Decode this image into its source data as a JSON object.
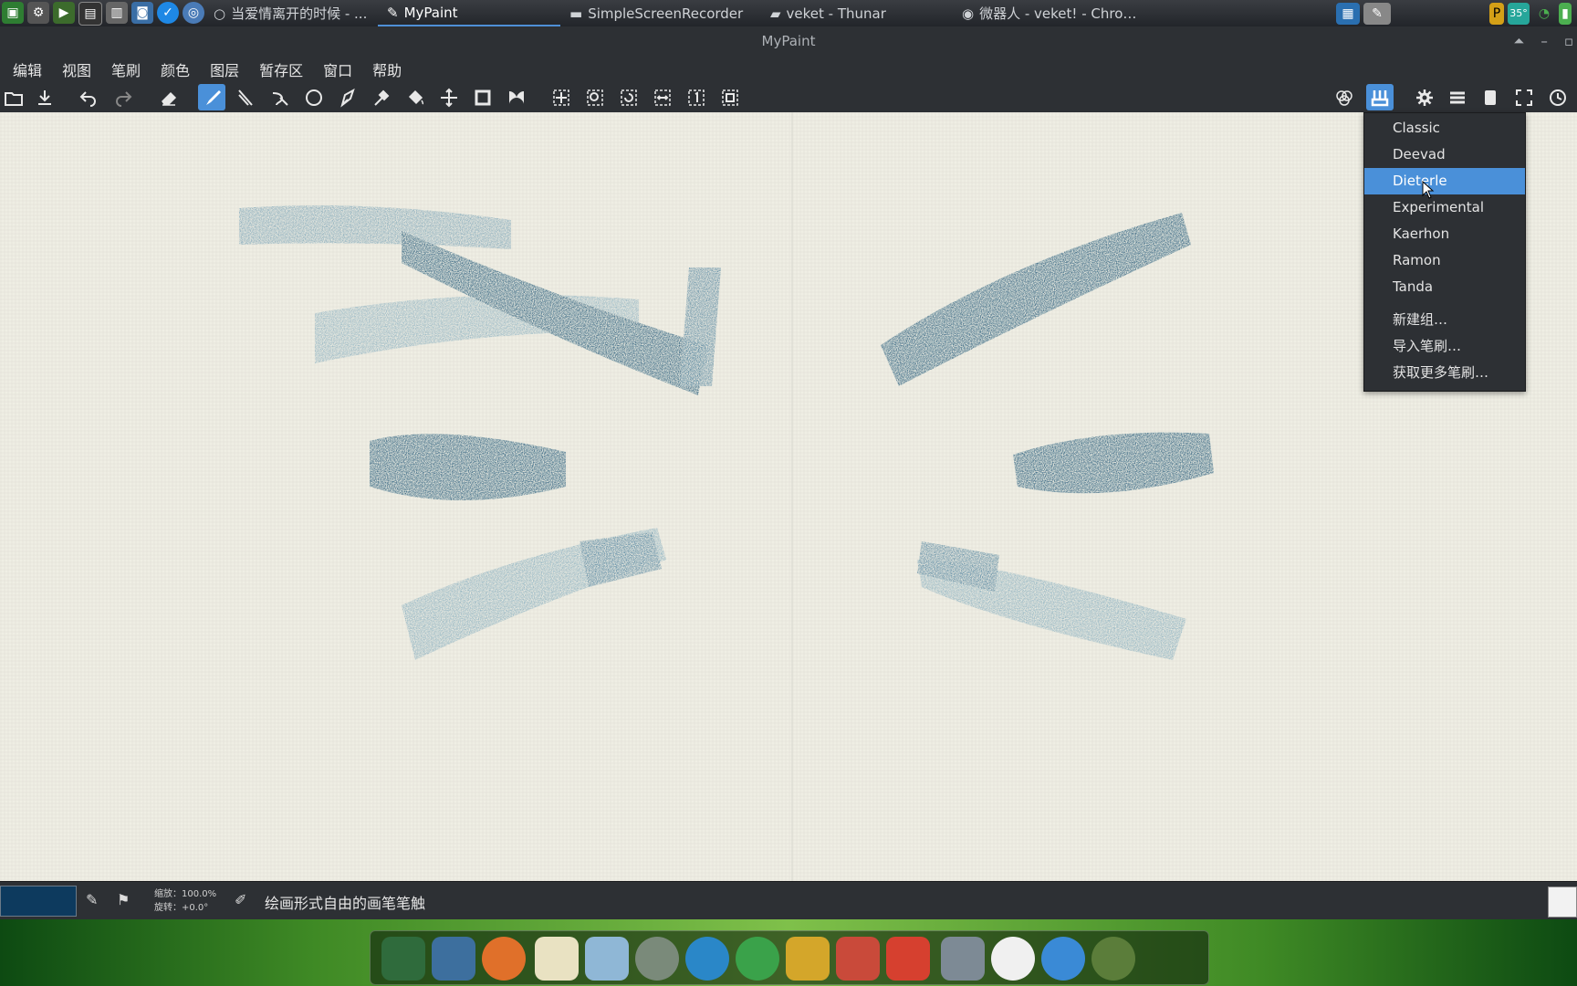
{
  "taskbar": {
    "tasks": [
      {
        "label": "当爱情离开的时候 - ..."
      },
      {
        "label": "MyPaint"
      },
      {
        "label": "SimpleScreenRecorder"
      },
      {
        "label": "veket - Thunar"
      },
      {
        "label": "微器人 - veket! - Chro…"
      }
    ],
    "temperature": "35°"
  },
  "window": {
    "title": "MyPaint"
  },
  "menu": {
    "items": [
      "编辑",
      "视图",
      "笔刷",
      "颜色",
      "图层",
      "暂存区",
      "窗口",
      "帮助"
    ]
  },
  "brush_groups_menu": {
    "items": [
      "Classic",
      "Deevad",
      "Dieterle",
      "Experimental",
      "Kaerhon",
      "Ramon",
      "Tanda"
    ],
    "selected": "Dieterle",
    "actions": [
      "新建组…",
      "导入笔刷…",
      "获取更多笔刷…"
    ]
  },
  "status": {
    "zoom_label": "缩放：100.0%",
    "rotate_label": "旋转：+0.0°",
    "message": "绘画形式自由的画笔笔触",
    "color": "#0d3a5e"
  },
  "colors": {
    "accent": "#4a90d9",
    "ink": "#0f4a6e",
    "canvas": "#efeee4"
  }
}
